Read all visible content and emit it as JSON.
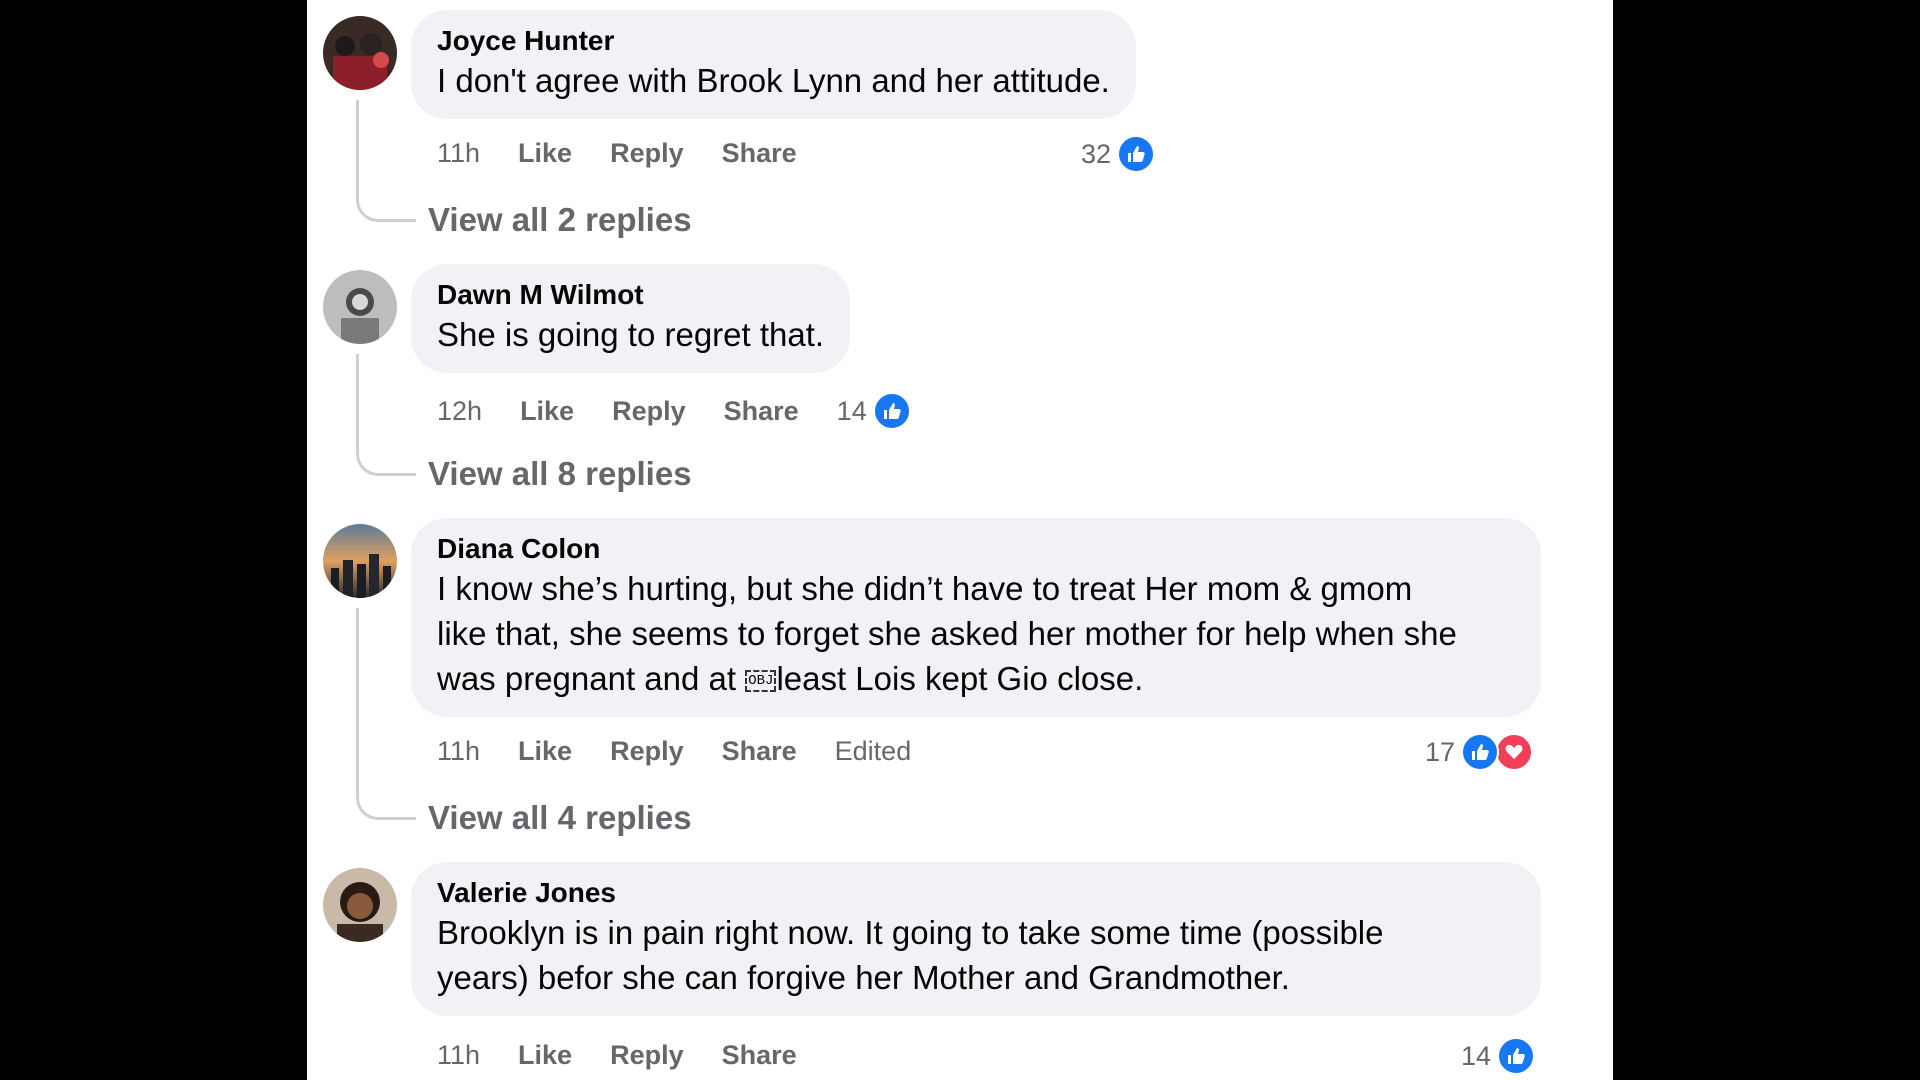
{
  "colors": {
    "background": "#000000",
    "panel": "#ffffff",
    "bubble": "#f0f2f5",
    "secondary_text": "#65676b",
    "like_blue": "#1877f2",
    "love_red": "#f33e58"
  },
  "comments": [
    {
      "author": "Joyce Hunter",
      "text": "I don't agree with Brook Lynn and her attitude.",
      "time": "11h",
      "like": "Like",
      "reply": "Reply",
      "share": "Share",
      "reaction_count": "32",
      "reactions": [
        "like-icon"
      ],
      "view_replies": "View all 2 replies"
    },
    {
      "author": "Dawn M Wilmot",
      "text": "She is going to regret that.",
      "time": "12h",
      "like": "Like",
      "reply": "Reply",
      "share": "Share",
      "reaction_count": "14",
      "reactions": [
        "like-icon"
      ],
      "view_replies": "View all 8 replies"
    },
    {
      "author": "Diana Colon",
      "text_line1": "I know she’s hurting, but she didn’t have to treat Her mom & gmom",
      "text_line2": "like that, she seems to forget she asked her mother for help when she",
      "text_line3_a": "was pregnant and at ",
      "obj_marker": "OBJ",
      "text_line3_b": "least Lois kept Gio close.",
      "time": "11h",
      "like": "Like",
      "reply": "Reply",
      "share": "Share",
      "edited": "Edited",
      "reaction_count": "17",
      "reactions": [
        "like-icon",
        "heart-icon"
      ],
      "view_replies": "View all 4 replies"
    },
    {
      "author": "Valerie Jones",
      "text_line1": "Brooklyn is in pain right now. It going to take some time (possible",
      "text_line2": "years) befor she can forgive her Mother and Grandmother.",
      "time": "11h",
      "like": "Like",
      "reply": "Reply",
      "share": "Share",
      "reaction_count": "14",
      "reactions": [
        "like-icon"
      ]
    }
  ]
}
